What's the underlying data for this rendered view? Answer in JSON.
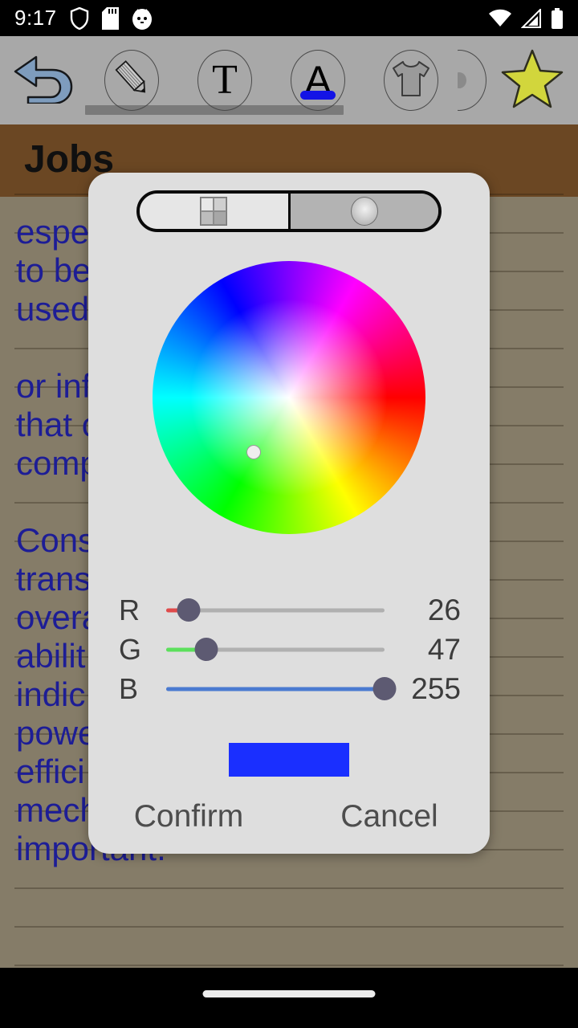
{
  "statusbar": {
    "time": "9:17",
    "left_icons": [
      "shield-icon",
      "sd-card-icon",
      "cat-app-icon"
    ],
    "right_icons": [
      "wifi-icon",
      "cellular-signal-icon",
      "battery-icon"
    ]
  },
  "toolbar": {
    "items": [
      {
        "name": "undo-button",
        "icon": "undo-arrow-icon",
        "label": ""
      },
      {
        "name": "pencil-tool-button",
        "icon": "pencil-icon",
        "label": ""
      },
      {
        "name": "text-tool-button",
        "icon": "text-t-icon",
        "label": "T"
      },
      {
        "name": "font-color-button",
        "icon": "font-a-underline-icon",
        "label": "A"
      },
      {
        "name": "shirt-tool-button",
        "icon": "shirt-icon",
        "label": ""
      },
      {
        "name": "partial-tool-button",
        "icon": "circle-dot-icon",
        "label": ""
      },
      {
        "name": "favorite-button",
        "icon": "star-icon",
        "label": ""
      }
    ],
    "accent_underline_color": "#1414e6"
  },
  "note": {
    "title": "Jobs",
    "paper_color": "#857c68",
    "header_color": "#6b4723",
    "text_color": "#1d1d96",
    "lines": [
      "espe                           cted",
      "to be                            nd",
      "used",
      "",
      "or inf                           rm",
      "that c",
      "comp",
      "",
      "Cons",
      "trans                           ect",
      "overa",
      "abilit                        aper",
      "indic                            n",
      "powe",
      "effici                           e",
      "mech                         ntly",
      "important."
    ]
  },
  "dialog": {
    "name": "color-picker-dialog",
    "segmented": {
      "left": {
        "name": "palette-grid-tab",
        "icon": "grid-icon",
        "selected": false
      },
      "right": {
        "name": "color-wheel-tab",
        "icon": "circle-icon",
        "selected": true
      }
    },
    "wheel": {
      "name": "color-wheel",
      "handle_x_pct": 37,
      "handle_y_pct": 70
    },
    "sliders": [
      {
        "label": "R",
        "value": "26",
        "percent": 10.2,
        "fill": "#e04a4a"
      },
      {
        "label": "G",
        "value": "47",
        "percent": 18.4,
        "fill": "#5ce05c"
      },
      {
        "label": "B",
        "value": "255",
        "percent": 100,
        "fill": "#4a7ad0"
      }
    ],
    "preview_color": "#1a2fff",
    "confirm_label": "Confirm",
    "cancel_label": "Cancel"
  },
  "navbar": {
    "home_indicator": "home-pill"
  }
}
